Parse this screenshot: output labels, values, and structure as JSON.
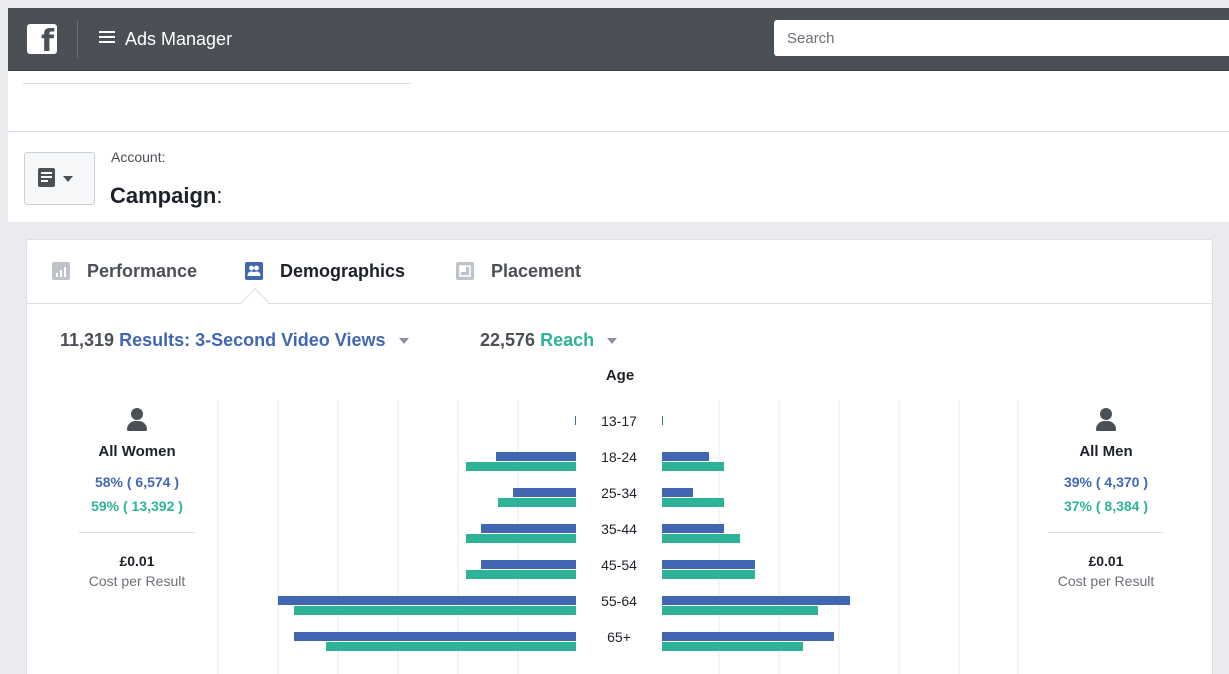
{
  "topbar": {
    "logo_letter": "f",
    "app_title": "Ads Manager",
    "search_placeholder": "Search"
  },
  "header": {
    "account_label": "Account",
    "account_suffix": ":",
    "campaign_label": "Campaign",
    "campaign_suffix": ":"
  },
  "tabs": [
    {
      "label": "Performance",
      "icon": "bar-chart-icon",
      "active": false
    },
    {
      "label": "Demographics",
      "icon": "people-icon",
      "active": true
    },
    {
      "label": "Placement",
      "icon": "placement-icon",
      "active": false
    }
  ],
  "metrics": {
    "results_count": "11,319",
    "results_label": "Results: 3-Second Video Views",
    "reach_count": "22,576",
    "reach_label": "Reach"
  },
  "women": {
    "label": "All Women",
    "results_pct": "58% ( 6,574 )",
    "reach_pct": "59% ( 13,392 )",
    "cost": "£0.01",
    "cost_label": "Cost per Result"
  },
  "men": {
    "label": "All Men",
    "results_pct": "39% ( 4,370 )",
    "reach_pct": "37% ( 8,384 )",
    "cost": "£0.01",
    "cost_label": "Cost per Result"
  },
  "colors": {
    "results": "#4267b2",
    "reach": "#2eb398",
    "topbar": "#4b4f56"
  },
  "chart_data": {
    "type": "bar",
    "title": "Age",
    "categories": [
      "13-17",
      "18-24",
      "25-34",
      "35-44",
      "45-54",
      "55-64",
      "65+"
    ],
    "series": [
      {
        "name": "Women – Results: 3-Second Video Views",
        "values": [
          1,
          80,
          63,
          95,
          95,
          298,
          282
        ]
      },
      {
        "name": "Women – Reach",
        "values": [
          0,
          110,
          78,
          110,
          110,
          282,
          250
        ]
      },
      {
        "name": "Men – Results: 3-Second Video Views",
        "values": [
          1,
          47,
          31,
          62,
          93,
          188,
          172
        ]
      },
      {
        "name": "Men – Reach",
        "values": [
          0,
          62,
          62,
          78,
          93,
          156,
          141
        ]
      }
    ],
    "xlim": [
      0,
      300
    ],
    "grid": true,
    "legend": "none"
  }
}
